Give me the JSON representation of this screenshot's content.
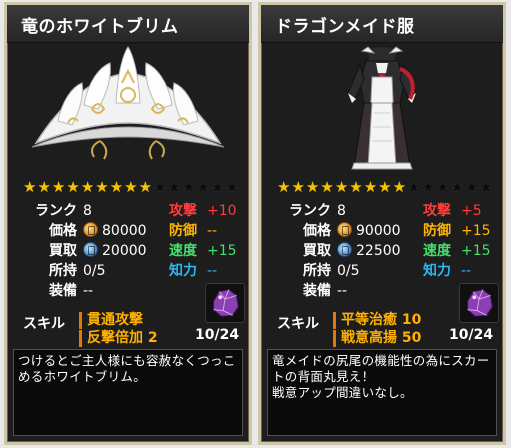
{
  "cards": [
    {
      "title": "竜のホワイトブリム",
      "stars_filled": 9,
      "stars_total": 15,
      "rank": {
        "label": "ランク",
        "value": "8"
      },
      "price": {
        "label": "価格",
        "value": "80000",
        "icon": "price-coin-icon"
      },
      "buy": {
        "label": "買取",
        "value": "20000",
        "icon": "buy-coin-icon"
      },
      "owned": {
        "label": "所持",
        "value": "0/5"
      },
      "equip": {
        "label": "装備",
        "value": "--"
      },
      "effects": [
        {
          "label": "攻撃",
          "value": "+10",
          "color": "#ff3b3b"
        },
        {
          "label": "防御",
          "value": "--",
          "color": "#ffb400"
        },
        {
          "label": "速度",
          "value": "+15",
          "color": "#45e06a"
        },
        {
          "label": "知力",
          "value": "--",
          "color": "#2ab7f2"
        }
      ],
      "skill_label": "スキル",
      "skills": [
        "貫通攻撃",
        "反撃倍加 2"
      ],
      "gem_count": "10/24",
      "description": "つけるとご主人様にも容赦なくつっこ\nめるホワイトブリム。"
    },
    {
      "title": "ドラゴンメイド服",
      "stars_filled": 9,
      "stars_total": 15,
      "rank": {
        "label": "ランク",
        "value": "8"
      },
      "price": {
        "label": "価格",
        "value": "90000",
        "icon": "price-coin-icon"
      },
      "buy": {
        "label": "買取",
        "value": "22500",
        "icon": "buy-coin-icon"
      },
      "owned": {
        "label": "所持",
        "value": "0/5"
      },
      "equip": {
        "label": "装備",
        "value": "--"
      },
      "effects": [
        {
          "label": "攻撃",
          "value": "+5",
          "color": "#ff3b3b"
        },
        {
          "label": "防御",
          "value": "+15",
          "color": "#ffb400"
        },
        {
          "label": "速度",
          "value": "+15",
          "color": "#45e06a"
        },
        {
          "label": "知力",
          "value": "--",
          "color": "#2ab7f2"
        }
      ],
      "skill_label": "スキル",
      "skills": [
        "平等治癒 10",
        "戦意高揚 50"
      ],
      "gem_count": "10/24",
      "description": "竜メイドの尻尾の機能性の為にスカー\nトの背面丸見え！\n戦意アップ間違いなし。"
    }
  ]
}
